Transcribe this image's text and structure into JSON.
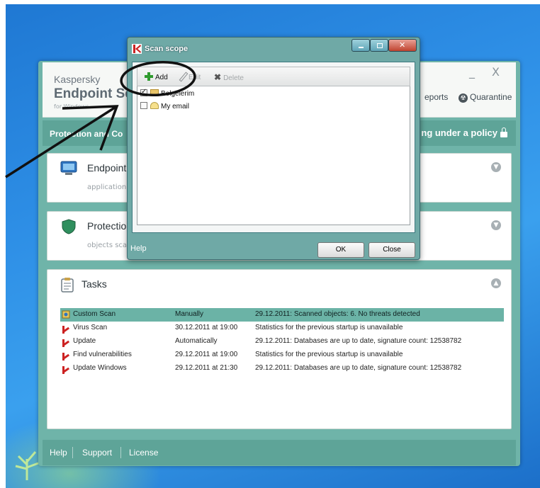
{
  "main_window": {
    "brand_small": "Kaspersky",
    "brand_big": "Endpoint Sec",
    "brand_tiny": "for Windows",
    "minimize_glyph": "_",
    "close_glyph": "X",
    "reports_link": "eports",
    "quarantine_link": "Quarantine",
    "policy_left": "Protection and Co",
    "policy_right": "ng under a policy",
    "panels": {
      "endpoint": {
        "title": "Endpoint co",
        "subtitle": "application star"
      },
      "protection": {
        "title": "Protection e",
        "subtitle": "objects scanne"
      },
      "tasks": {
        "title": "Tasks"
      }
    },
    "tasks": [
      {
        "name": "Custom Scan",
        "schedule": "Manually",
        "status": "29.12.2011: Scanned objects: 6. No threats detected",
        "selected": true,
        "icon": "custom-scan-icon"
      },
      {
        "name": "Virus Scan",
        "schedule": "30.12.2011 at 19:00",
        "status": "Statistics for the previous startup is unavailable",
        "selected": false,
        "icon": "kaspersky-k-icon"
      },
      {
        "name": "Update",
        "schedule": "Automatically",
        "status": "29.12.2011: Databases are up to date, signature count: 12538782",
        "selected": false,
        "icon": "kaspersky-k-icon"
      },
      {
        "name": "Find vulnerabilities",
        "schedule": "29.12.2011 at 19:00",
        "status": "Statistics for the previous startup is unavailable",
        "selected": false,
        "icon": "kaspersky-k-icon"
      },
      {
        "name": "Update Windows",
        "schedule": "29.12.2011 at 21:30",
        "status": "29.12.2011: Databases are up to date, signature count: 12538782",
        "selected": false,
        "icon": "kaspersky-k-icon"
      }
    ],
    "footer": {
      "help": "Help",
      "support": "Support",
      "license": "License"
    }
  },
  "dialog": {
    "title": "Scan scope",
    "toolbar": {
      "add": "Add",
      "edit": "Edit",
      "delete": "Delete"
    },
    "items": [
      {
        "label": "Belgelerim",
        "checked": true,
        "icon": "folder-icon"
      },
      {
        "label": "My email",
        "checked": false,
        "icon": "mail-icon"
      }
    ],
    "help": "Help",
    "ok": "OK",
    "close": "Close"
  },
  "colors": {
    "accent_teal": "#5ea498",
    "selected_row": "#6bb3a6",
    "desktop_blue": "#2e8fe6"
  }
}
